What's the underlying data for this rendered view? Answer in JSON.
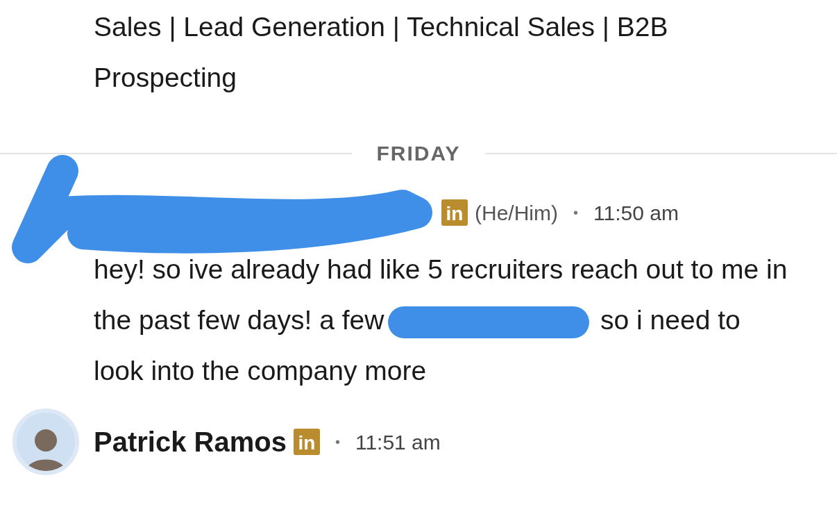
{
  "headline": "Sales | Lead Generation | Technical Sales | B2B Prospecting",
  "day_divider": "FRIDAY",
  "messages": [
    {
      "kind": "redacted_sender",
      "badge": "in",
      "pronouns": "(He/Him)",
      "separator": "•",
      "time": "11:50 am",
      "text_before": "hey! so ive already had like 5 recruiters reach out to me in the past few days! a few",
      "text_after": "so i need to look into the company more"
    },
    {
      "kind": "named_sender",
      "name": "Patrick Ramos",
      "badge": "in",
      "separator": "•",
      "time": "11:51 am"
    }
  ]
}
